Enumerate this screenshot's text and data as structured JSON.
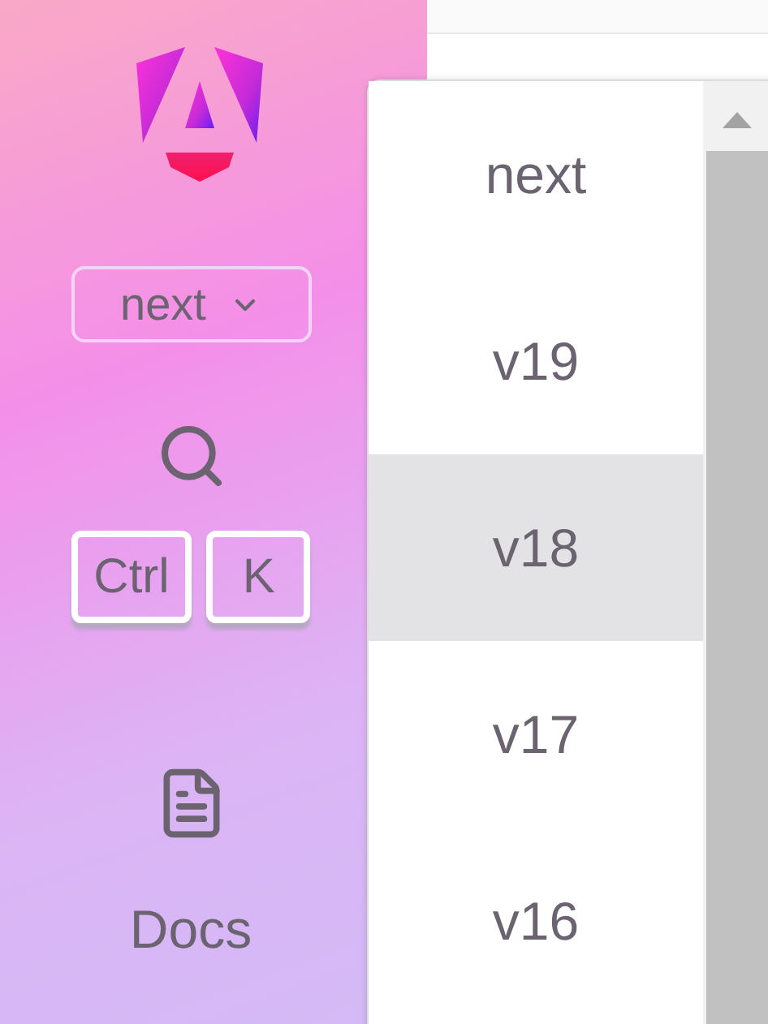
{
  "version_button": {
    "label": "next"
  },
  "search": {
    "keys": [
      "Ctrl",
      "K"
    ]
  },
  "nav": [
    {
      "label": "Docs"
    }
  ],
  "version_menu": {
    "options": [
      {
        "label": "next",
        "hovered": false
      },
      {
        "label": "v19",
        "hovered": false
      },
      {
        "label": "v18",
        "hovered": true
      },
      {
        "label": "v17",
        "hovered": false
      },
      {
        "label": "v16",
        "hovered": false
      }
    ]
  }
}
